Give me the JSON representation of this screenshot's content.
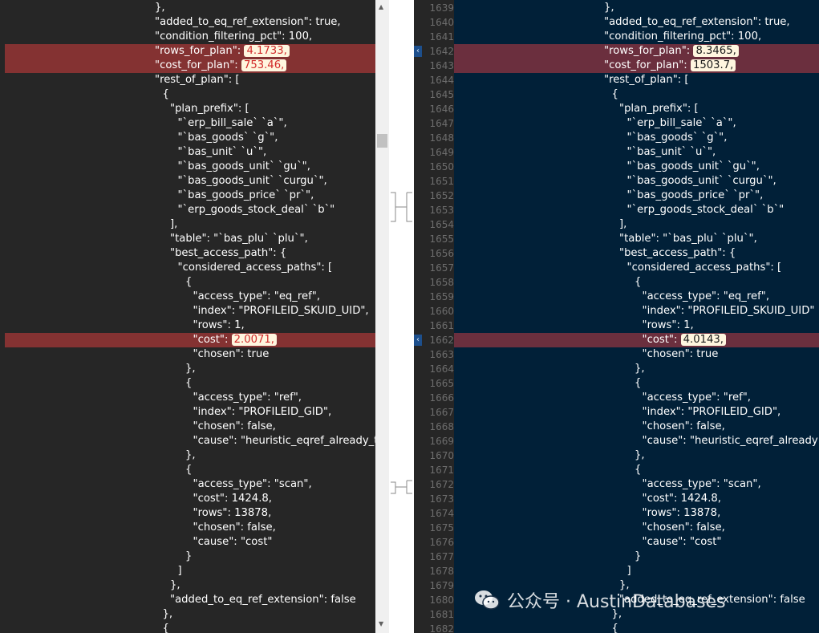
{
  "left": {
    "lines": [
      {
        "t": "},"
      },
      {
        "t": "\"added_to_eq_ref_extension\": true,"
      },
      {
        "t": "\"condition_filtering_pct\": 100,"
      },
      {
        "t": "\"rows_for_plan\":",
        "v": "4.1733,"
      },
      {
        "t": "\"cost_for_plan\":",
        "v": "753.46,"
      },
      {
        "t": "\"rest_of_plan\": ["
      },
      {
        "t": "{"
      },
      {
        "t": "\"plan_prefix\": ["
      },
      {
        "t": "\"`erp_bill_sale` `a`\","
      },
      {
        "t": "\"`bas_goods` `g`\","
      },
      {
        "t": "\"`bas_unit` `u`\","
      },
      {
        "t": "\"`bas_goods_unit` `gu`\","
      },
      {
        "t": "\"`bas_goods_unit` `curgu`\","
      },
      {
        "t": "\"`bas_goods_price` `pr`\","
      },
      {
        "t": "\"`erp_goods_stock_deal` `b`\""
      },
      {
        "t": "],"
      },
      {
        "t": "\"table\": \"`bas_plu` `plu`\","
      },
      {
        "t": "\"best_access_path\": {"
      },
      {
        "t": "\"considered_access_paths\": ["
      },
      {
        "t": "{"
      },
      {
        "t": "\"access_type\": \"eq_ref\","
      },
      {
        "t": "\"index\": \"PROFILEID_SKUID_UID\","
      },
      {
        "t": "\"rows\": 1,"
      },
      {
        "t": "\"cost\":",
        "v": "2.0071,"
      },
      {
        "t": "\"chosen\": true"
      },
      {
        "t": "},"
      },
      {
        "t": "{"
      },
      {
        "t": "\"access_type\": \"ref\","
      },
      {
        "t": "\"index\": \"PROFILEID_GID\","
      },
      {
        "t": "\"chosen\": false,"
      },
      {
        "t": "\"cause\": \"heuristic_eqref_already_t"
      },
      {
        "t": "},"
      },
      {
        "t": "{"
      },
      {
        "t": "\"access_type\": \"scan\","
      },
      {
        "t": "\"cost\": 1424.8,"
      },
      {
        "t": "\"rows\": 13878,"
      },
      {
        "t": "\"chosen\": false,"
      },
      {
        "t": "\"cause\": \"cost\""
      },
      {
        "t": "}"
      },
      {
        "t": "]"
      },
      {
        "t": "},"
      },
      {
        "t": "\"added_to_eq_ref_extension\": false"
      },
      {
        "t": "},"
      },
      {
        "t": "{"
      }
    ]
  },
  "right": {
    "line_numbers": [
      "1639",
      "1640",
      "1641",
      "1642",
      "1643",
      "1644",
      "1645",
      "1646",
      "1647",
      "1648",
      "1649",
      "1650",
      "1651",
      "1652",
      "1653",
      "1654",
      "1655",
      "1656",
      "1657",
      "1658",
      "1659",
      "1660",
      "1661",
      "1662",
      "1663",
      "1664",
      "1665",
      "1666",
      "1667",
      "1668",
      "1669",
      "1670",
      "1671",
      "1672",
      "1673",
      "1674",
      "1675",
      "1676",
      "1677",
      "1678",
      "1679",
      "1680",
      "1681",
      "1682"
    ],
    "lines": [
      {
        "t": "},"
      },
      {
        "t": "\"added_to_eq_ref_extension\": true,"
      },
      {
        "t": "\"condition_filtering_pct\": 100,"
      },
      {
        "t": "\"rows_for_plan\":",
        "v": "8.3465,"
      },
      {
        "t": "\"cost_for_plan\":",
        "v": "1503.7,"
      },
      {
        "t": "\"rest_of_plan\": ["
      },
      {
        "t": "{"
      },
      {
        "t": "\"plan_prefix\": ["
      },
      {
        "t": "\"`erp_bill_sale` `a`\","
      },
      {
        "t": "\"`bas_goods` `g`\","
      },
      {
        "t": "\"`bas_unit` `u`\","
      },
      {
        "t": "\"`bas_goods_unit` `gu`\","
      },
      {
        "t": "\"`bas_goods_unit` `curgu`\","
      },
      {
        "t": "\"`bas_goods_price` `pr`\","
      },
      {
        "t": "\"`erp_goods_stock_deal` `b`\""
      },
      {
        "t": "],"
      },
      {
        "t": "\"table\": \"`bas_plu` `plu`\","
      },
      {
        "t": "\"best_access_path\": {"
      },
      {
        "t": "\"considered_access_paths\": ["
      },
      {
        "t": "{"
      },
      {
        "t": "\"access_type\": \"eq_ref\","
      },
      {
        "t": "\"index\": \"PROFILEID_SKUID_UID\""
      },
      {
        "t": "\"rows\": 1,"
      },
      {
        "t": "\"cost\":",
        "v": "4.0143,"
      },
      {
        "t": "\"chosen\": true"
      },
      {
        "t": "},"
      },
      {
        "t": "{"
      },
      {
        "t": "\"access_type\": \"ref\","
      },
      {
        "t": "\"index\": \"PROFILEID_GID\","
      },
      {
        "t": "\"chosen\": false,"
      },
      {
        "t": "\"cause\": \"heuristic_eqref_already"
      },
      {
        "t": "},"
      },
      {
        "t": "{"
      },
      {
        "t": "\"access_type\": \"scan\","
      },
      {
        "t": "\"cost\": 1424.8,"
      },
      {
        "t": "\"rows\": 13878,"
      },
      {
        "t": "\"chosen\": false,"
      },
      {
        "t": "\"cause\": \"cost\""
      },
      {
        "t": "}"
      },
      {
        "t": "]"
      },
      {
        "t": "},"
      },
      {
        "t": "\"added_to_eq_ref_extension\": false"
      },
      {
        "t": "},"
      },
      {
        "t": "{"
      }
    ]
  },
  "watermark": {
    "text": "公众号 · AustinDatabases",
    "icon": "wechat-icon"
  },
  "colors": {
    "changed_left": "#843232",
    "changed_right": "#6b2f3e",
    "right_bg": "#012038",
    "left_bg": "#262626"
  }
}
